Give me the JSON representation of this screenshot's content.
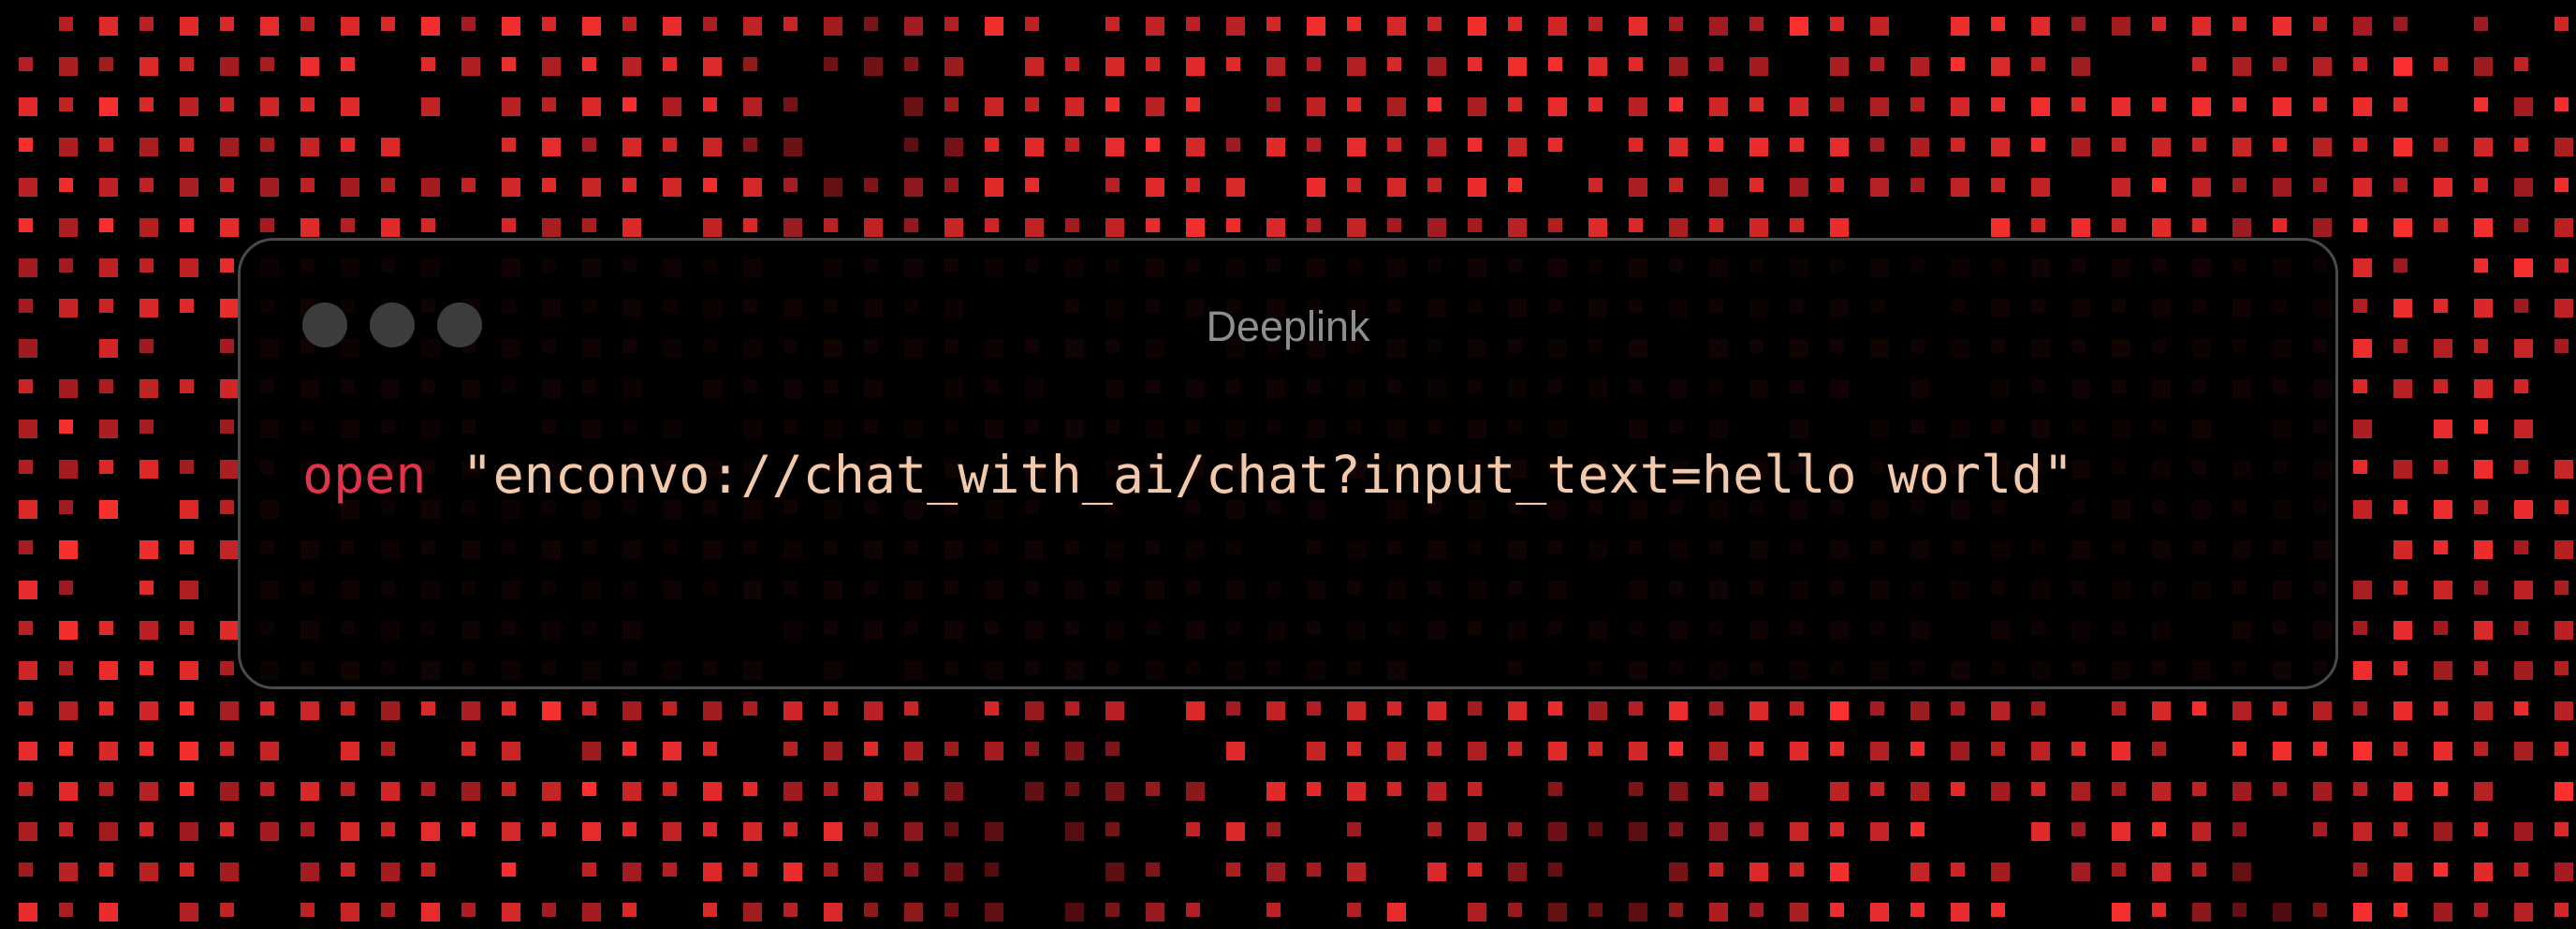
{
  "window": {
    "title": "Deeplink"
  },
  "command": {
    "keyword": "open",
    "argument": "\"enconvo://chat_with_ai/chat?input_text=hello world\""
  },
  "colors": {
    "background": "#000000",
    "pixel_accent": "#e8202e",
    "keyword": "#e0344a",
    "argument": "#f2c9aa",
    "title": "#8e8e8e",
    "window_border": "#4a4a4a",
    "traffic_dot": "#3c3c3c"
  },
  "icons": {
    "traffic_lights": [
      "window-dot-icon",
      "window-dot-icon",
      "window-dot-icon"
    ]
  }
}
